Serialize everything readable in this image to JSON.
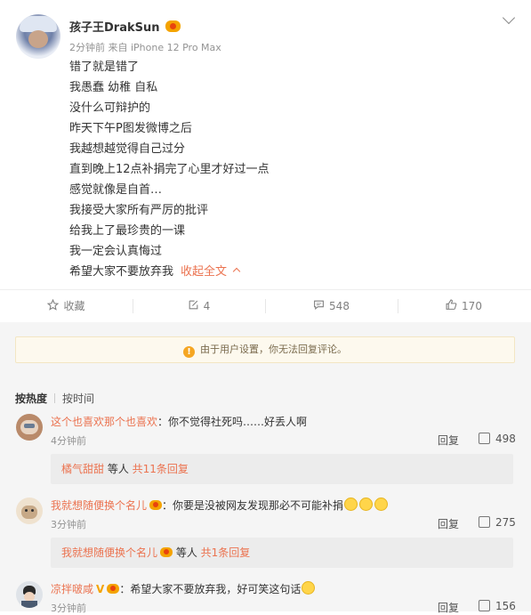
{
  "post": {
    "username": "孩子王DrakSun",
    "meta": "2分钟前 来自 iPhone 12 Pro Max",
    "lines": [
      "错了就是错了",
      "我愚蠢 幼稚 自私",
      "没什么可辩护的",
      "昨天下午P图发微博之后",
      "我越想越觉得自己过分",
      "直到晚上12点补捐完了心里才好过一点",
      "感觉就像是自首…",
      "我接受大家所有严厉的批评",
      "给我上了最珍贵的一课",
      "我一定会认真悔过",
      "希望大家不要放弃我"
    ],
    "collapse_label": "收起全文"
  },
  "actions": {
    "favorite": "收藏",
    "repost": "4",
    "comment": "548",
    "like": "170"
  },
  "comments": {
    "notice": "由于用户设置，你无法回复评论。",
    "sort_hot": "按热度",
    "sort_time": "按时间",
    "reply_label": "回复",
    "items": [
      {
        "name": "这个也喜欢那个也喜欢",
        "text": "：你不觉得社死吗……好丢人啊",
        "time": "4分钟前",
        "likes": "498",
        "sub_name": "橘气甜甜",
        "sub_mid": " 等人 ",
        "sub_count": "共11条回复"
      },
      {
        "name": "我就想随便换个名儿",
        "text": "：你要是没被网友发现那必不可能补捐",
        "time": "3分钟前",
        "likes": "275",
        "sub_name": "我就想随便换个名儿",
        "sub_mid": " 等人 ",
        "sub_count": "共1条回复"
      },
      {
        "name": "凉拌啵咸",
        "text": "：希望大家不要放弃我，好可笑这句话",
        "time": "3分钟前",
        "likes": "156"
      }
    ]
  }
}
